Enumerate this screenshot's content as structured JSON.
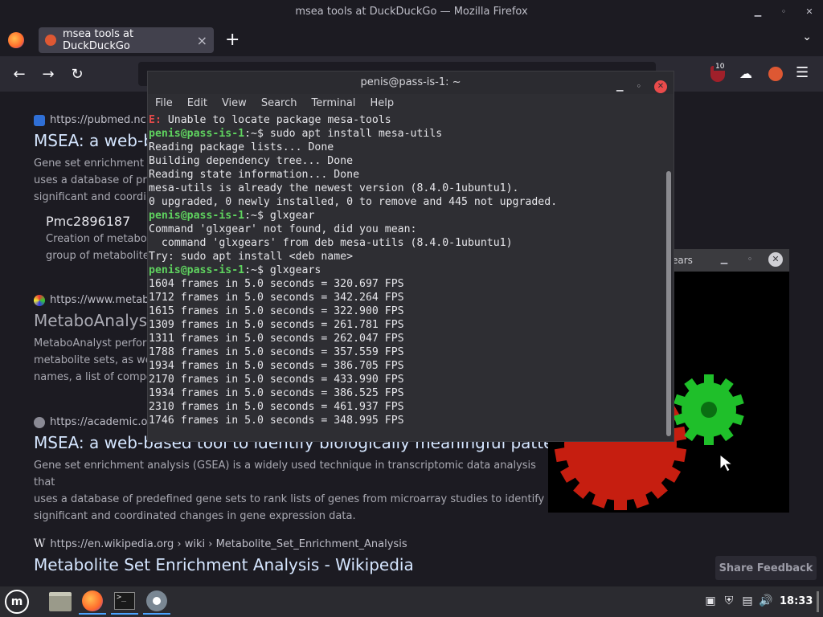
{
  "firefox": {
    "window_title": "msea tools at DuckDuckGo — Mozilla Firefox",
    "tab_title": "msea tools at DuckDuckGo",
    "tab_close": "×",
    "new_tab": "+",
    "ext_badge": "10"
  },
  "results": [
    {
      "url": "https://pubmed.nc",
      "title": "MSEA: a web-b",
      "snippet": [
        "Gene set enrichment a",
        "uses a database of pred",
        "significant and coordin"
      ],
      "sub_title": "Pmc2896187",
      "sub_snippet": [
        "Creation of metabol",
        "group of metabolite"
      ]
    },
    {
      "url": "https://www.metab",
      "title": "MetaboAnalyst",
      "snippet": [
        "MetaboAnalyst perfor",
        "metabolite sets, as we",
        "names, a list of compo"
      ]
    },
    {
      "url": "https://academic.o",
      "title": "MSEA: a web-based tool to identify biologically meaningful patterns i...",
      "snippet": [
        "Gene set enrichment analysis (GSEA) is a widely used technique in transcriptomic data analysis that",
        "uses a database of predefined gene sets to rank lists of genes from microarray studies to identify",
        "significant and coordinated changes in gene expression data."
      ]
    },
    {
      "url": "https://en.wikipedia.org › wiki › Metabolite_Set_Enrichment_Analysis",
      "title": "Metabolite Set Enrichment Analysis - Wikipedia"
    }
  ],
  "share_feedback": "Share Feedback",
  "gears": {
    "title": "ears"
  },
  "terminal": {
    "title": "penis@pass-is-1: ~",
    "menu": [
      "File",
      "Edit",
      "View",
      "Search",
      "Terminal",
      "Help"
    ],
    "prompt": "penis@pass-is-1",
    "prompt_suffix": ":~$ ",
    "lines": [
      {
        "type": "err",
        "prefix": "E:",
        "text": " Unable to locate package mesa-tools"
      },
      {
        "type": "cmd",
        "text": "sudo apt install mesa-utils"
      },
      {
        "type": "out",
        "text": "Reading package lists... Done"
      },
      {
        "type": "out",
        "text": "Building dependency tree... Done"
      },
      {
        "type": "out",
        "text": "Reading state information... Done"
      },
      {
        "type": "out",
        "text": "mesa-utils is already the newest version (8.4.0-1ubuntu1)."
      },
      {
        "type": "out",
        "text": "0 upgraded, 0 newly installed, 0 to remove and 445 not upgraded."
      },
      {
        "type": "cmd",
        "text": "glxgear"
      },
      {
        "type": "out",
        "text": "Command 'glxgear' not found, did you mean:"
      },
      {
        "type": "out",
        "text": "  command 'glxgears' from deb mesa-utils (8.4.0-1ubuntu1)"
      },
      {
        "type": "out",
        "text": "Try: sudo apt install <deb name>"
      },
      {
        "type": "cmd",
        "text": "glxgears"
      },
      {
        "type": "out",
        "text": "1604 frames in 5.0 seconds = 320.697 FPS"
      },
      {
        "type": "out",
        "text": "1712 frames in 5.0 seconds = 342.264 FPS"
      },
      {
        "type": "out",
        "text": "1615 frames in 5.0 seconds = 322.900 FPS"
      },
      {
        "type": "out",
        "text": "1309 frames in 5.0 seconds = 261.781 FPS"
      },
      {
        "type": "out",
        "text": "1311 frames in 5.0 seconds = 262.047 FPS"
      },
      {
        "type": "out",
        "text": "1788 frames in 5.0 seconds = 357.559 FPS"
      },
      {
        "type": "out",
        "text": "1934 frames in 5.0 seconds = 386.705 FPS"
      },
      {
        "type": "out",
        "text": "2170 frames in 5.0 seconds = 433.990 FPS"
      },
      {
        "type": "out",
        "text": "1934 frames in 5.0 seconds = 386.525 FPS"
      },
      {
        "type": "out",
        "text": "2310 frames in 5.0 seconds = 461.937 FPS"
      },
      {
        "type": "out",
        "text": "1746 frames in 5.0 seconds = 348.995 FPS"
      }
    ]
  },
  "taskbar": {
    "clock": "18:33"
  },
  "colors": {
    "prompt": "#5fd35f",
    "error": "#e24a4a",
    "terminal_bg": "#2e2e33",
    "firefox_bg": "#1c1b22",
    "close": "#e94b4b"
  }
}
